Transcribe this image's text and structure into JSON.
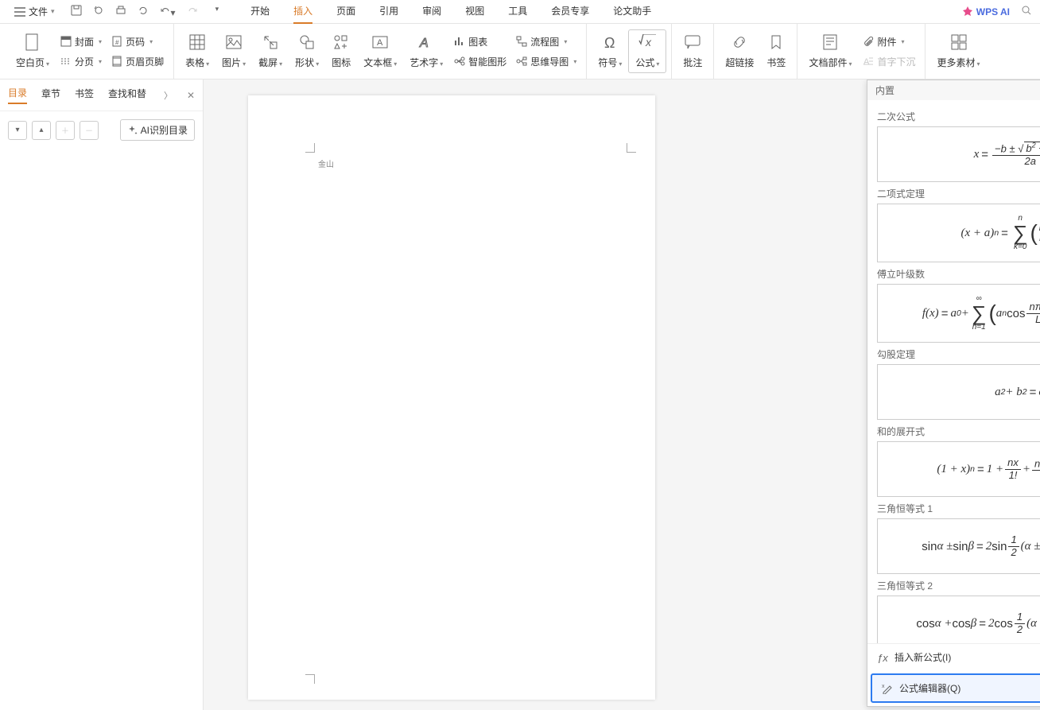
{
  "menu": {
    "file": "文件",
    "tabs": [
      "开始",
      "插入",
      "页面",
      "引用",
      "审阅",
      "视图",
      "工具",
      "会员专享",
      "论文助手"
    ],
    "wpsai": "WPS AI"
  },
  "ribbon": {
    "blank_page": "空白页",
    "cover": "封面",
    "page_num": "页码",
    "page_break": "分页",
    "header_footer": "页眉页脚",
    "table": "表格",
    "picture": "图片",
    "screenshot": "截屏",
    "shapes": "形状",
    "icons": "图标",
    "textbox": "文本框",
    "wordart": "艺术字",
    "chart": "图表",
    "flowchart": "流程图",
    "smartart": "智能图形",
    "mindmap": "思维导图",
    "symbol": "符号",
    "equation": "公式",
    "comment": "批注",
    "hyperlink": "超链接",
    "bookmark": "书签",
    "docparts": "文档部件",
    "attachment": "附件",
    "dropcap": "首字下沉",
    "more": "更多素材"
  },
  "sidepanel": {
    "tabs": [
      "目录",
      "章节",
      "书签",
      "查找和替"
    ],
    "ai_toc": "AI识别目录"
  },
  "page": {
    "header_text": "金山"
  },
  "dropdown": {
    "header": "内置",
    "items": [
      {
        "label": "二次公式"
      },
      {
        "label": "二项式定理"
      },
      {
        "label": "傅立叶级数"
      },
      {
        "label": "勾股定理"
      },
      {
        "label": "和的展开式"
      },
      {
        "label": "三角恒等式 1"
      },
      {
        "label": "三角恒等式 2"
      }
    ],
    "insert_new": "插入新公式(I)",
    "editor": "公式编辑器(Q)"
  }
}
